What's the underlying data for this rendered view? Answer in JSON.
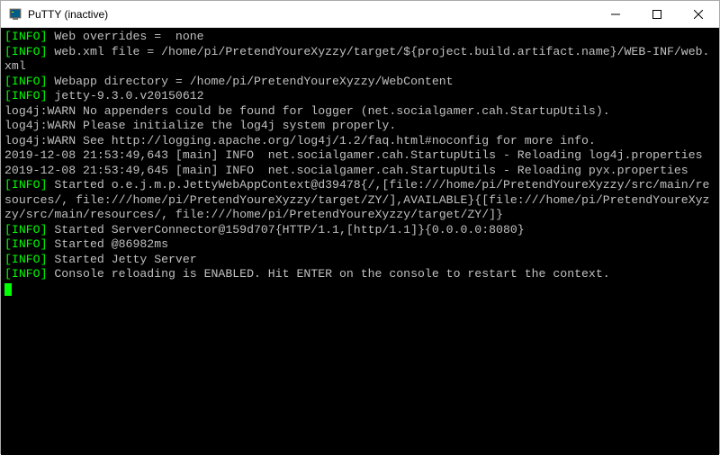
{
  "window": {
    "title": "PuTTY (inactive)"
  },
  "terminal": {
    "lines": [
      {
        "prefix": "[INFO]",
        "text": " Web overrides =  none"
      },
      {
        "prefix": "[INFO]",
        "text": " web.xml file = /home/pi/PretendYoureXyzzy/target/${project.build.artifact.name}/WEB-INF/web.xml"
      },
      {
        "prefix": "[INFO]",
        "text": " Webapp directory = /home/pi/PretendYoureXyzzy/WebContent"
      },
      {
        "prefix": "[INFO]",
        "text": " jetty-9.3.0.v20150612"
      },
      {
        "prefix": "",
        "text": "log4j:WARN No appenders could be found for logger (net.socialgamer.cah.StartupUtils)."
      },
      {
        "prefix": "",
        "text": "log4j:WARN Please initialize the log4j system properly."
      },
      {
        "prefix": "",
        "text": "log4j:WARN See http://logging.apache.org/log4j/1.2/faq.html#noconfig for more info."
      },
      {
        "prefix": "",
        "text": "2019-12-08 21:53:49,643 [main] INFO  net.socialgamer.cah.StartupUtils - Reloading log4j.properties"
      },
      {
        "prefix": "",
        "text": "2019-12-08 21:53:49,645 [main] INFO  net.socialgamer.cah.StartupUtils - Reloading pyx.properties"
      },
      {
        "prefix": "[INFO]",
        "text": " Started o.e.j.m.p.JettyWebAppContext@d39478{/,[file:///home/pi/PretendYoureXyzzy/src/main/resources/, file:///home/pi/PretendYoureXyzzy/target/ZY/],AVAILABLE}{[file:///home/pi/PretendYoureXyzzy/src/main/resources/, file:///home/pi/PretendYoureXyzzy/target/ZY/]}"
      },
      {
        "prefix": "[INFO]",
        "text": " Started ServerConnector@159d707{HTTP/1.1,[http/1.1]}{0.0.0.0:8080}"
      },
      {
        "prefix": "[INFO]",
        "text": " Started @86982ms"
      },
      {
        "prefix": "[INFO]",
        "text": " Started Jetty Server"
      },
      {
        "prefix": "[INFO]",
        "text": " Console reloading is ENABLED. Hit ENTER on the console to restart the context."
      }
    ]
  }
}
